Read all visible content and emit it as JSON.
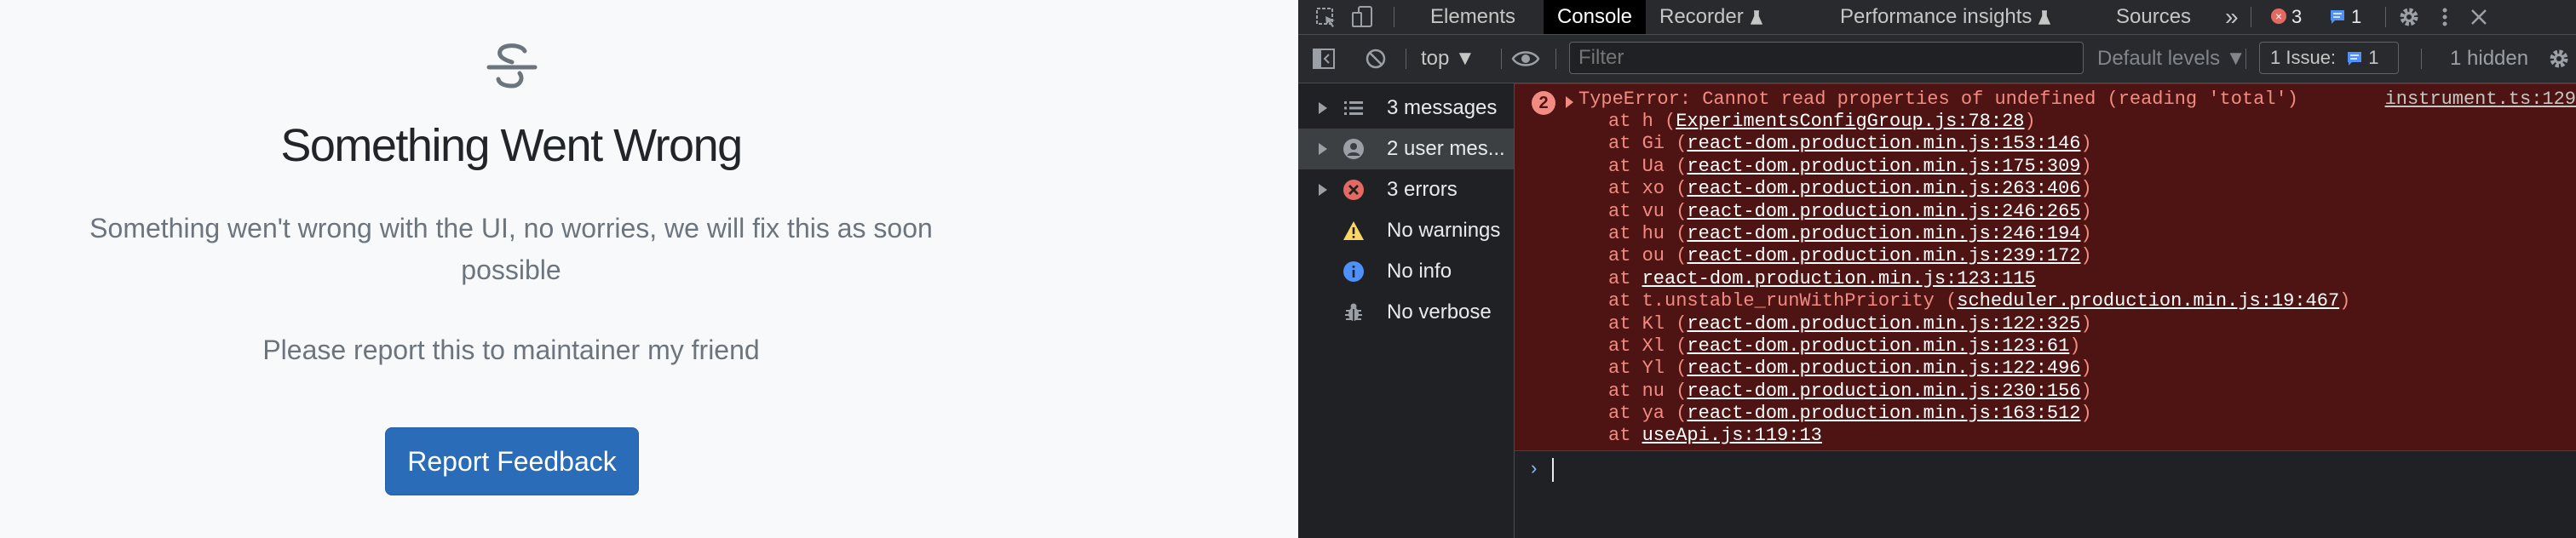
{
  "app": {
    "title": "Something Went Wrong",
    "description": "Something wen't wrong with the UI, no worries, we will fix this as soon possible",
    "report_text": "Please report this to maintainer my friend",
    "button_label": "Report Feedback",
    "icon": "strikethrough-icon"
  },
  "devtools": {
    "tabs": [
      {
        "label": "Elements"
      },
      {
        "label": "Console"
      },
      {
        "label": "Recorder"
      },
      {
        "label": "Performance insights"
      },
      {
        "label": "Sources"
      }
    ],
    "more_tabs": "»",
    "error_badge_count": "3",
    "message_badge_count": "1",
    "toolbar": {
      "context": "top ▼",
      "filter_placeholder": "Filter",
      "levels": "Default levels ▼",
      "issues_label": "1 Issue:",
      "issues_count": "1",
      "hidden": "1 hidden"
    },
    "sidebar": [
      {
        "label": "3 messages",
        "icon": "list-icon"
      },
      {
        "label": "2 user mes...",
        "icon": "user-icon"
      },
      {
        "label": "3 errors",
        "icon": "error-icon"
      },
      {
        "label": "No warnings",
        "icon": "warning-icon"
      },
      {
        "label": "No info",
        "icon": "info-icon"
      },
      {
        "label": "No verbose",
        "icon": "bug-icon"
      }
    ],
    "console": {
      "repeat_count": "2",
      "error_message": "TypeError: Cannot read properties of undefined (reading 'total')",
      "error_source": "instrument.ts:129",
      "frames": [
        {
          "prefix": "at h (",
          "link": "ExperimentsConfigGroup.js:78:28",
          "suffix": ")"
        },
        {
          "prefix": "at Gi (",
          "link": "react-dom.production.min.js:153:146",
          "suffix": ")"
        },
        {
          "prefix": "at Ua (",
          "link": "react-dom.production.min.js:175:309",
          "suffix": ")"
        },
        {
          "prefix": "at xo (",
          "link": "react-dom.production.min.js:263:406",
          "suffix": ")"
        },
        {
          "prefix": "at vu (",
          "link": "react-dom.production.min.js:246:265",
          "suffix": ")"
        },
        {
          "prefix": "at hu (",
          "link": "react-dom.production.min.js:246:194",
          "suffix": ")"
        },
        {
          "prefix": "at ou (",
          "link": "react-dom.production.min.js:239:172",
          "suffix": ")"
        },
        {
          "prefix": "at ",
          "link": "react-dom.production.min.js:123:115",
          "suffix": ""
        },
        {
          "prefix": "at t.unstable_runWithPriority (",
          "link": "scheduler.production.min.js:19:467",
          "suffix": ")"
        },
        {
          "prefix": "at Kl (",
          "link": "react-dom.production.min.js:122:325",
          "suffix": ")"
        },
        {
          "prefix": "at Xl (",
          "link": "react-dom.production.min.js:123:61",
          "suffix": ")"
        },
        {
          "prefix": "at Yl (",
          "link": "react-dom.production.min.js:122:496",
          "suffix": ")"
        },
        {
          "prefix": "at nu (",
          "link": "react-dom.production.min.js:230:156",
          "suffix": ")"
        },
        {
          "prefix": "at ya (",
          "link": "react-dom.production.min.js:163:512",
          "suffix": ")"
        },
        {
          "prefix": "at ",
          "link": "useApi.js:119:13",
          "suffix": ""
        }
      ],
      "prompt": "›"
    },
    "colors": {
      "accent": "#2b6cb8",
      "error_bg": "#4e1413",
      "error_text": "#f28b82"
    }
  }
}
